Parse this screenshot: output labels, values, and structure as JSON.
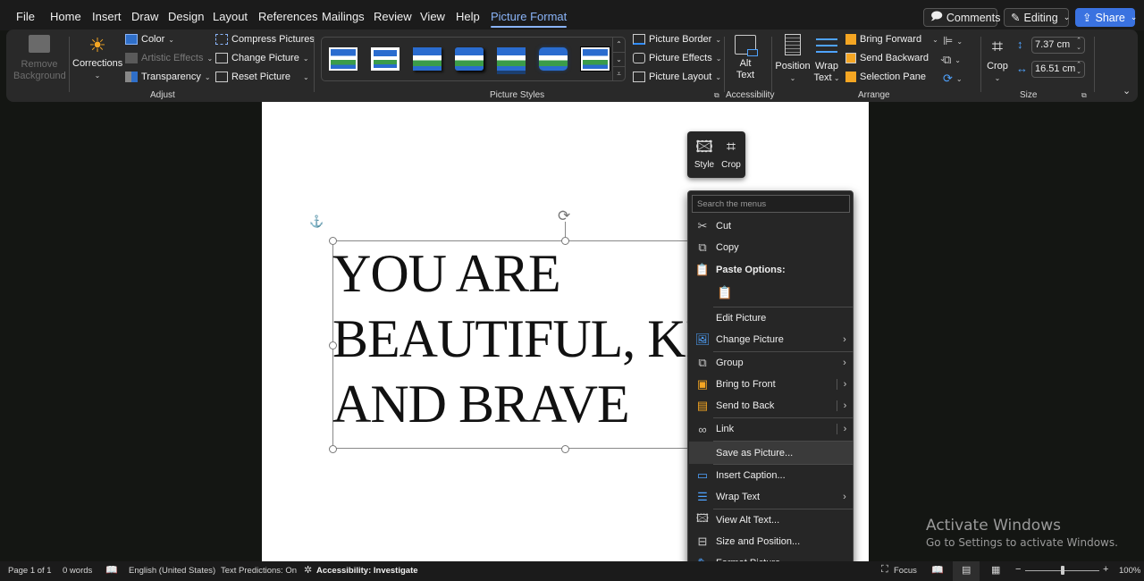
{
  "menubar": {
    "tabs": [
      "File",
      "Home",
      "Insert",
      "Draw",
      "Design",
      "Layout",
      "References",
      "Mailings",
      "Review",
      "View",
      "Help",
      "Picture Format"
    ],
    "active_tab": "Picture Format",
    "comments_label": "Comments",
    "editing_label": "Editing",
    "share_label": "Share"
  },
  "ribbon": {
    "adjust": {
      "remove_background": [
        "Remove",
        "Background"
      ],
      "corrections": "Corrections",
      "color": "Color",
      "artistic_effects": "Artistic Effects",
      "transparency": "Transparency",
      "compress_pictures": "Compress Pictures",
      "change_picture": "Change Picture",
      "reset_picture": "Reset Picture",
      "group_label": "Adjust"
    },
    "picture_styles": {
      "thumbnail_count": 7,
      "picture_border": "Picture Border",
      "picture_effects": "Picture Effects",
      "picture_layout": "Picture Layout",
      "group_label": "Picture Styles"
    },
    "accessibility": {
      "alt_text": [
        "Alt",
        "Text"
      ],
      "group_label": "Accessibility"
    },
    "arrange": {
      "position": "Position",
      "wrap_text": [
        "Wrap",
        "Text"
      ],
      "bring_forward": "Bring Forward",
      "send_backward": "Send Backward",
      "selection_pane": "Selection Pane",
      "group_label": "Arrange"
    },
    "size": {
      "crop": "Crop",
      "height": "7.37 cm",
      "width": "16.51 cm",
      "group_label": "Size"
    }
  },
  "document": {
    "lines": [
      "YOU ARE",
      "BEAUTIFUL, KIND,",
      "AND BRAVE"
    ]
  },
  "mini_toolbar": {
    "style_label": "Style",
    "crop_label": "Crop"
  },
  "context_menu": {
    "search_placeholder": "Search the menus",
    "items": [
      {
        "label": "Cut",
        "icon": "scissors-icon"
      },
      {
        "label": "Copy",
        "icon": "copy-icon"
      },
      {
        "label": "Paste Options:",
        "icon": "paste-icon"
      },
      {
        "label": "Edit Picture",
        "icon": ""
      },
      {
        "label": "Change Picture",
        "icon": "change-picture-icon"
      },
      {
        "label": "Group",
        "icon": "group-icon"
      },
      {
        "label": "Bring to Front",
        "icon": "bring-to-front-icon"
      },
      {
        "label": "Send to Back",
        "icon": "send-to-back-icon"
      },
      {
        "label": "Link",
        "icon": "link-icon"
      },
      {
        "label": "Save as Picture...",
        "icon": ""
      },
      {
        "label": "Insert Caption...",
        "icon": "caption-icon"
      },
      {
        "label": "Wrap Text",
        "icon": "wrap-text-icon"
      },
      {
        "label": "View Alt Text...",
        "icon": "alt-text-icon"
      },
      {
        "label": "Size and Position...",
        "icon": "size-position-icon"
      },
      {
        "label": "Format Picture...",
        "icon": "format-picture-icon"
      }
    ]
  },
  "watermark": {
    "title": "Activate Windows",
    "subtitle": "Go to Settings to activate Windows."
  },
  "statusbar": {
    "page": "Page 1 of 1",
    "words": "0 words",
    "language": "English (United States)",
    "text_predictions": "Text Predictions: On",
    "accessibility": "Accessibility: Investigate",
    "focus": "Focus",
    "zoom": "100%",
    "zoom_minus": "−",
    "zoom_plus": "+"
  },
  "colors": {
    "accent": "#8ab4f8",
    "share": "#3a72e0",
    "ribbon_bg": "#292929",
    "menu_bg": "#262626"
  }
}
